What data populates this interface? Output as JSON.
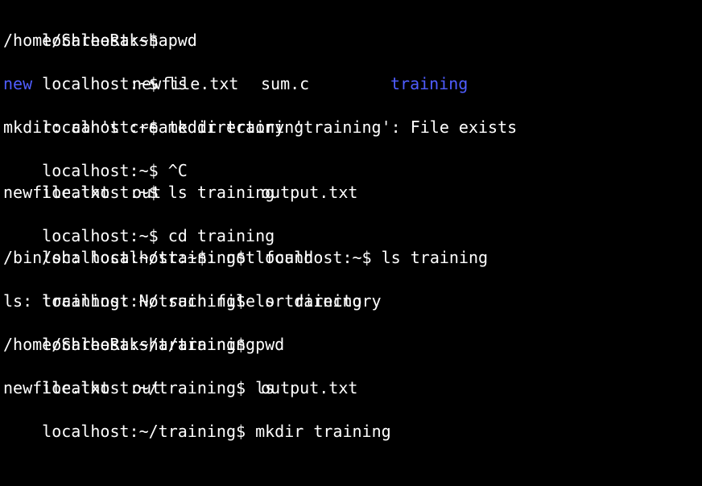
{
  "colors": {
    "background": "#000000",
    "text": "#ffffff",
    "directory": "#4f5dff"
  },
  "lines": [
    {
      "prompt": "localhost:~$",
      "cmd": " pwd"
    },
    {
      "text": "/home/ShreeRaksha"
    },
    {
      "prompt": "localhost:~$",
      "cmd": " ls"
    },
    {
      "ls": [
        "new",
        "newfile.txt",
        "sum.c",
        "training"
      ]
    },
    {
      "prompt": "localhost:~$",
      "cmd": " mkdir training"
    },
    {
      "text": "mkdir: can't create directory 'training': File exists"
    },
    {
      "prompt": "localhost:~$",
      "cmd": " ^C"
    },
    {
      "prompt": "localhost:~$",
      "cmd": " ls training"
    },
    {
      "ls": [
        "newfile.txt",
        "out",
        "output.txt"
      ]
    },
    {
      "prompt": "localhost:~$",
      "cmd": " cd training"
    },
    {
      "prompt": "localhost:~/training$",
      "cmd": " localhost:~$ ls training"
    },
    {
      "text": "/bin/sh: localhost:~$: not found"
    },
    {
      "prompt": "localhost:~/training$",
      "cmd": " ls training"
    },
    {
      "text": "ls: training: No such file or directory"
    },
    {
      "prompt": "localhost:~/training$",
      "cmd": " pwd"
    },
    {
      "text": "/home/ShreeRaksha/training"
    },
    {
      "prompt": "localhost:~/training$",
      "cmd": " ls"
    },
    {
      "ls": [
        "newfile.txt",
        "out",
        "output.txt"
      ]
    },
    {
      "prompt": "localhost:~/training$",
      "cmd": " mkdir training"
    }
  ]
}
